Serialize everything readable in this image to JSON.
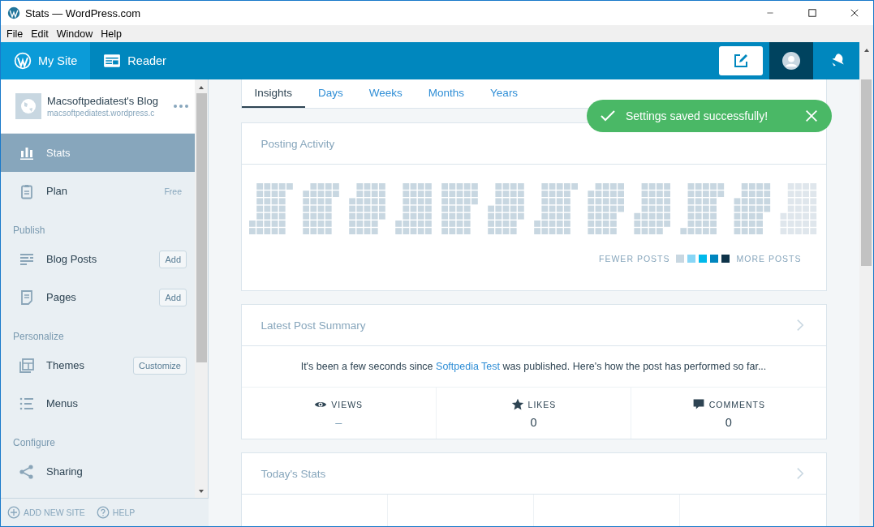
{
  "window": {
    "title": "Stats — WordPress.com"
  },
  "menu": [
    "File",
    "Edit",
    "Window",
    "Help"
  ],
  "masterbar": {
    "items": [
      {
        "label": "My Site",
        "selected": true
      },
      {
        "label": "Reader",
        "selected": false
      }
    ]
  },
  "sidebar": {
    "site": {
      "name": "Macsoftpediatest's Blog",
      "url": "macsoftpediatest.wordpress.c"
    },
    "items": [
      {
        "kind": "item",
        "label": "Stats",
        "selected": true
      },
      {
        "kind": "item",
        "label": "Plan",
        "selected": false,
        "badge": "Free"
      },
      {
        "kind": "heading",
        "label": "Publish"
      },
      {
        "kind": "item",
        "label": "Blog Posts",
        "selected": false,
        "button": "Add"
      },
      {
        "kind": "item",
        "label": "Pages",
        "selected": false,
        "button": "Add"
      },
      {
        "kind": "heading",
        "label": "Personalize"
      },
      {
        "kind": "item",
        "label": "Themes",
        "selected": false,
        "button": "Customize"
      },
      {
        "kind": "item",
        "label": "Menus",
        "selected": false
      },
      {
        "kind": "heading",
        "label": "Configure"
      },
      {
        "kind": "item",
        "label": "Sharing",
        "selected": false
      }
    ],
    "footer": [
      "ADD NEW SITE",
      "HELP"
    ]
  },
  "tabs": [
    {
      "label": "Insights",
      "selected": true
    },
    {
      "label": "Days",
      "selected": false
    },
    {
      "label": "Weeks",
      "selected": false
    },
    {
      "label": "Months",
      "selected": false
    },
    {
      "label": "Years",
      "selected": false
    }
  ],
  "toast": {
    "message": "Settings saved successfully!"
  },
  "posting_activity": {
    "title": "Posting Activity",
    "legend": {
      "fewer": "FEWER POSTS",
      "more": "MORE POSTS",
      "levels": [
        {
          "color": "#c8d7e1"
        },
        {
          "color": "#88d6f6"
        },
        {
          "color": "#00b9eb"
        },
        {
          "color": "#0085be"
        },
        {
          "color": "#0e3349"
        }
      ]
    }
  },
  "latest_post": {
    "title": "Latest Post Summary",
    "summary_before": "It's been a few seconds since ",
    "link": "Softpedia Test",
    "summary_after": " was published. Here's how the post has performed so far...",
    "stats": [
      {
        "label": "VIEWS",
        "value": "–"
      },
      {
        "label": "LIKES",
        "value": "0"
      },
      {
        "label": "COMMENTS",
        "value": "0"
      }
    ]
  },
  "todays_stats": {
    "title": "Today's Stats"
  }
}
